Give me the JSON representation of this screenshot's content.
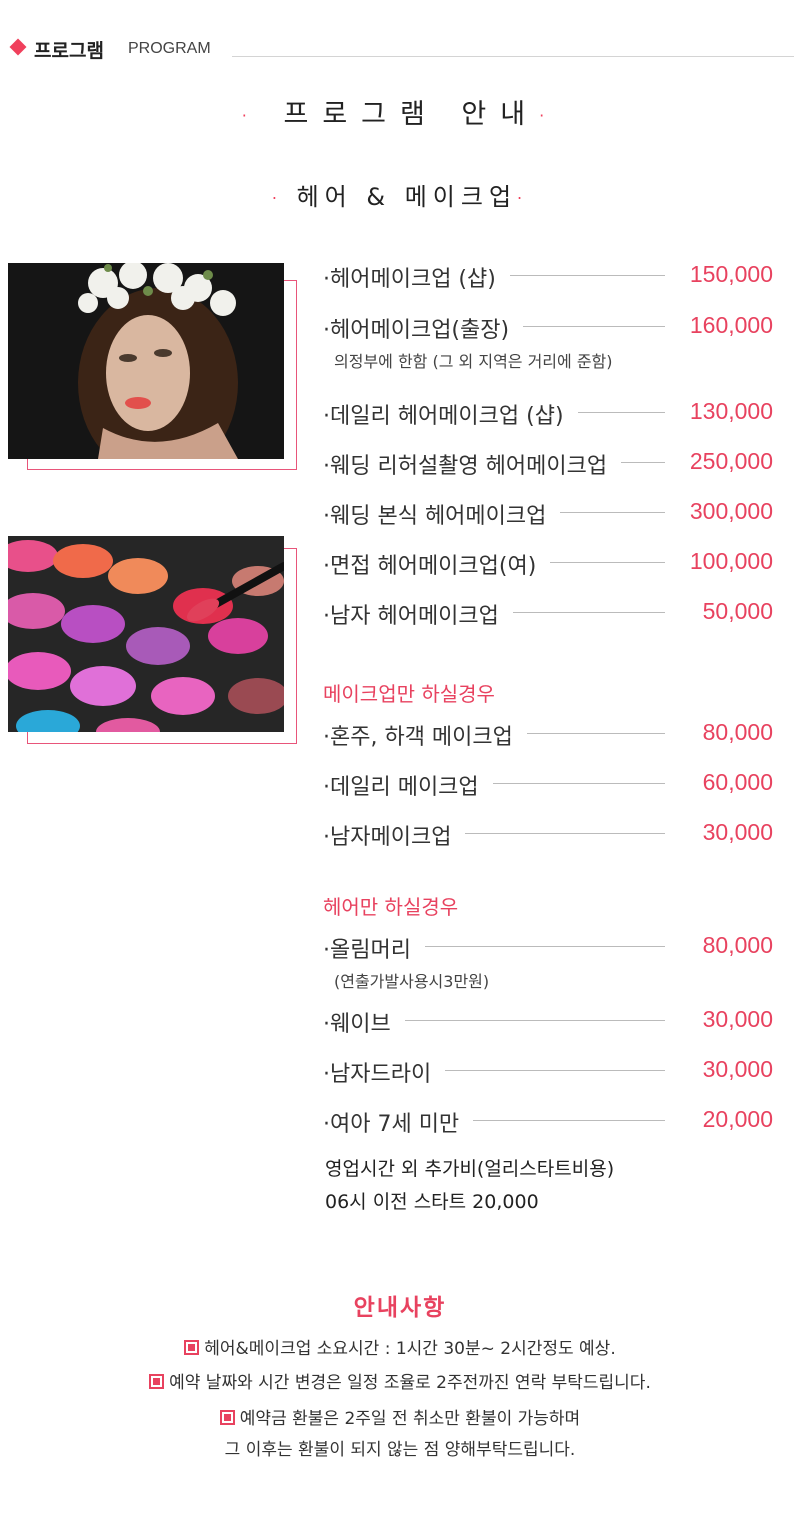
{
  "header": {
    "title_ko": "프로그램",
    "title_en": "PROGRAM"
  },
  "titles": {
    "main": "프로그램 안내",
    "sub": "헤어 & 메이크업"
  },
  "colors": {
    "accent": "#e8425f"
  },
  "hair_makeup": [
    {
      "name": "·헤어메이크업 (샵)",
      "price": "150,000"
    },
    {
      "name": "·헤어메이크업(출장)",
      "price": "160,000",
      "note": "의정부에 한함 (그 외 지역은 거리에 준함)"
    },
    {
      "name": "·데일리 헤어메이크업 (샵)",
      "price": "130,000"
    },
    {
      "name": "·웨딩 리허설촬영 헤어메이크업",
      "price": "250,000"
    },
    {
      "name": "·웨딩 본식 헤어메이크업",
      "price": "300,000"
    },
    {
      "name": "·면접 헤어메이크업(여)",
      "price": "100,000"
    },
    {
      "name": "·남자 헤어메이크업",
      "price": "50,000"
    }
  ],
  "makeup_only": {
    "heading": "메이크업만 하실경우",
    "items": [
      {
        "name": "·혼주, 하객 메이크업",
        "price": "80,000"
      },
      {
        "name": "·데일리 메이크업",
        "price": "60,000"
      },
      {
        "name": "·남자메이크업",
        "price": "30,000"
      }
    ]
  },
  "hair_only": {
    "heading": "헤어만 하실경우",
    "items": [
      {
        "name": "·올림머리",
        "price": "80,000",
        "note": "(연출가발사용시3만원)"
      },
      {
        "name": "·웨이브",
        "price": "30,000"
      },
      {
        "name": "·남자드라이",
        "price": "30,000"
      },
      {
        "name": "·여아 7세 미만",
        "price": "20,000"
      }
    ]
  },
  "extra": {
    "line1": "영업시간 외 추가비(얼리스타트비용)",
    "line2": "06시 이전 스타트 20,000"
  },
  "notice": {
    "title": "안내사항",
    "lines": [
      "헤어&메이크업 소요시간 : 1시간 30분~ 2시간정도 예상.",
      "예약 날짜와 시간 변경은 일정 조율로  2주전까진 연락 부탁드립니다.",
      "예약금 환불은 2주일 전 취소만 환불이 가능하며",
      "그 이후는 환불이 되지 않는 점 양해부탁드립니다."
    ]
  }
}
